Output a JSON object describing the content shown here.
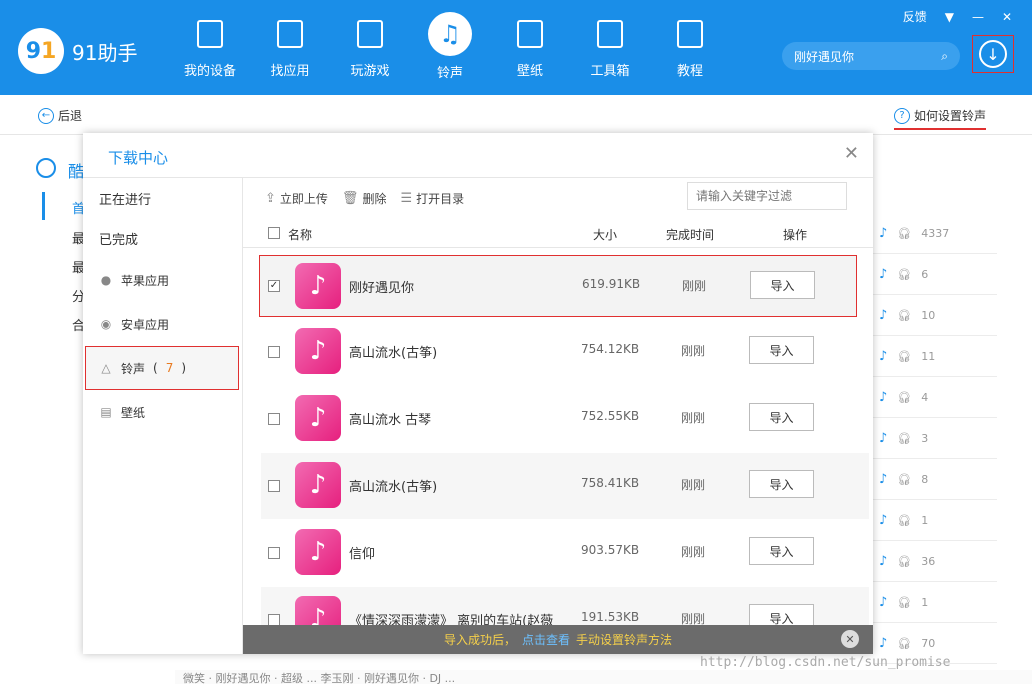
{
  "app": {
    "logo_mark": "9",
    "logo_mark2": "1",
    "logo_text": "91助手",
    "feedback": "反馈",
    "menu_icon": "▼",
    "minimize": "—",
    "close": "✕"
  },
  "nav": [
    {
      "label": "我的设备",
      "icon": "device-icon"
    },
    {
      "label": "找应用",
      "icon": "bag-icon"
    },
    {
      "label": "玩游戏",
      "icon": "gamepad-icon"
    },
    {
      "label": "铃声",
      "icon": "music-note-icon",
      "active": true
    },
    {
      "label": "壁纸",
      "icon": "picture-icon"
    },
    {
      "label": "工具箱",
      "icon": "toolbox-icon"
    },
    {
      "label": "教程",
      "icon": "doc-icon"
    }
  ],
  "search": {
    "value": "刚好遇见你"
  },
  "subbar": {
    "back": "后退",
    "howto": "如何设置铃声"
  },
  "bg_sidebar": {
    "category": "酷",
    "items": [
      "首",
      "最",
      "最",
      "分",
      "合"
    ]
  },
  "bg_rows": [
    {
      "count": "4337"
    },
    {
      "count": "6"
    },
    {
      "count": "10"
    },
    {
      "count": "11"
    },
    {
      "count": "4"
    },
    {
      "count": "3"
    },
    {
      "count": "8"
    },
    {
      "count": "1"
    },
    {
      "count": "36"
    },
    {
      "count": "1"
    },
    {
      "count": "70"
    }
  ],
  "bg_footer": "微笑 · 刚好遇见你 · 超级     ...     李玉刚 · 刚好遇见你 · DJ ...",
  "modal": {
    "title": "下载中心",
    "sidebar": {
      "in_progress": "正在进行",
      "completed": "已完成",
      "apple_apps": "苹果应用",
      "android_apps": "安卓应用",
      "ringtones": "铃声",
      "ringtone_count": "7",
      "wallpapers": "壁纸"
    },
    "toolbar": {
      "upload": "立即上传",
      "delete": "删除",
      "open_dir": "打开目录",
      "filter_placeholder": "请输入关键字过滤"
    },
    "columns": {
      "name": "名称",
      "size": "大小",
      "time": "完成时间",
      "action": "操作"
    },
    "rows": [
      {
        "name": "刚好遇见你",
        "size": "619.91KB",
        "time": "刚刚",
        "action": "导入",
        "checked": true
      },
      {
        "name": "高山流水(古筝)",
        "size": "754.12KB",
        "time": "刚刚",
        "action": "导入"
      },
      {
        "name": "高山流水 古琴",
        "size": "752.55KB",
        "time": "刚刚",
        "action": "导入"
      },
      {
        "name": "高山流水(古筝)",
        "size": "758.41KB",
        "time": "刚刚",
        "action": "导入"
      },
      {
        "name": "信仰",
        "size": "903.57KB",
        "time": "刚刚",
        "action": "导入"
      },
      {
        "name": "《情深深雨濛濛》 离别的车站(赵薇",
        "size": "191.53KB",
        "time": "刚刚",
        "action": "导入"
      }
    ],
    "toast": {
      "part1": "导入成功后，",
      "link": "点击查看",
      "part2": "手动设置铃声方法"
    }
  },
  "watermark": "http://blog.csdn.net/sun_promise",
  "colors": {
    "primary": "#1a8ee8",
    "highlight": "#e03030",
    "ring_icon": "#e6207e"
  }
}
